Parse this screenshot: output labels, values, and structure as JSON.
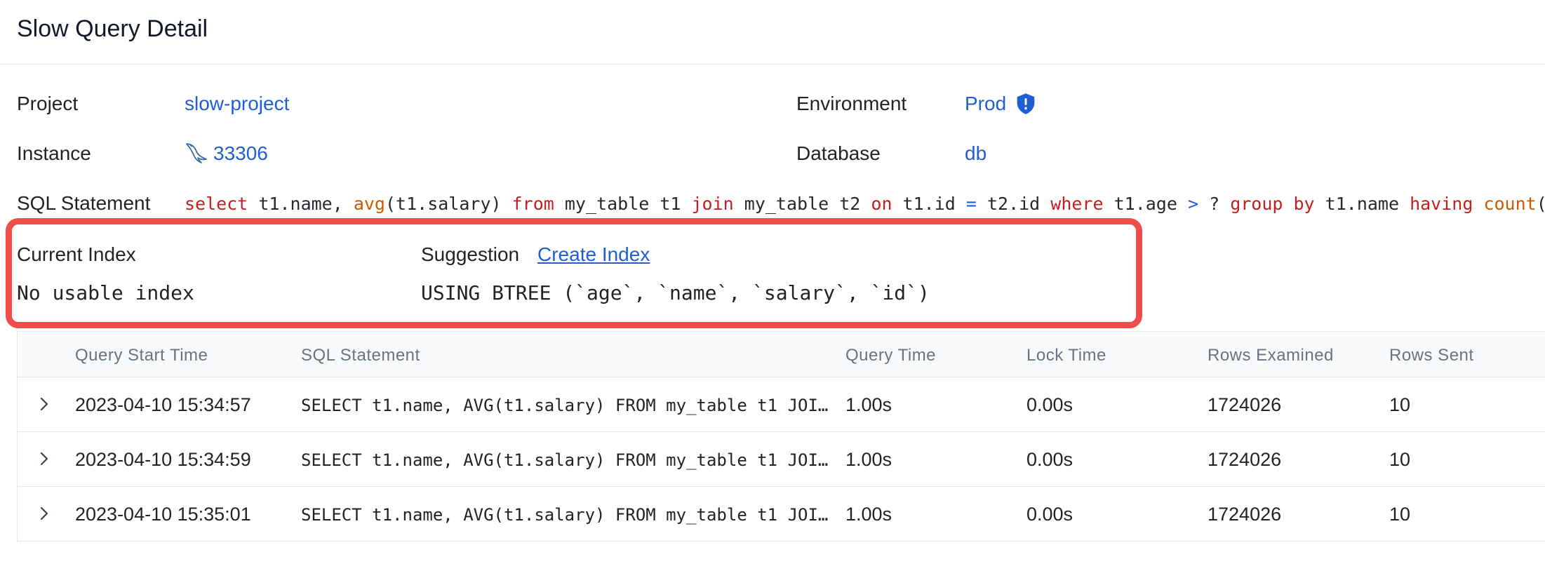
{
  "header": {
    "title": "Slow Query Detail"
  },
  "details": {
    "project_label": "Project",
    "project_value": "slow-project",
    "environment_label": "Environment",
    "environment_value": "Prod",
    "instance_label": "Instance",
    "instance_value": "33306",
    "database_label": "Database",
    "database_value": "db",
    "sql_label": "SQL Statement",
    "sql_tokens": [
      {
        "t": "select",
        "c": "kw"
      },
      {
        "t": " t1.name, ",
        "c": ""
      },
      {
        "t": "avg",
        "c": "fn"
      },
      {
        "t": "(t1.salary) ",
        "c": ""
      },
      {
        "t": "from",
        "c": "kw"
      },
      {
        "t": " my_table t1 ",
        "c": ""
      },
      {
        "t": "join",
        "c": "kw"
      },
      {
        "t": " my_table t2 ",
        "c": ""
      },
      {
        "t": "on",
        "c": "kw"
      },
      {
        "t": " t1.id ",
        "c": ""
      },
      {
        "t": "=",
        "c": "op"
      },
      {
        "t": " t2.id ",
        "c": ""
      },
      {
        "t": "where",
        "c": "kw"
      },
      {
        "t": " t1.age ",
        "c": ""
      },
      {
        "t": ">",
        "c": "op"
      },
      {
        "t": " ? ",
        "c": ""
      },
      {
        "t": "group by",
        "c": "kw"
      },
      {
        "t": " t1.name ",
        "c": ""
      },
      {
        "t": "having",
        "c": "kw"
      },
      {
        "t": " ",
        "c": ""
      },
      {
        "t": "count",
        "c": "fn"
      },
      {
        "t": "(",
        "c": ""
      },
      {
        "t": "*",
        "c": "op"
      },
      {
        "t": ") ",
        "c": ""
      },
      {
        "t": ">",
        "c": "op"
      }
    ]
  },
  "index_advice": {
    "current_label": "Current Index",
    "current_value": "No usable index",
    "suggestion_label": "Suggestion",
    "create_link": "Create Index",
    "suggestion_value": "USING BTREE (`age`, `name`, `salary`, `id`)"
  },
  "table": {
    "columns": [
      "Query Start Time",
      "SQL Statement",
      "Query Time",
      "Lock Time",
      "Rows Examined",
      "Rows Sent"
    ],
    "rows": [
      {
        "start": "2023-04-10 15:34:57",
        "sql": "SELECT t1.name, AVG(t1.salary) FROM my_table t1 JOI…",
        "query_time": "1.00s",
        "lock_time": "0.00s",
        "rows_examined": "1724026",
        "rows_sent": "10"
      },
      {
        "start": "2023-04-10 15:34:59",
        "sql": "SELECT t1.name, AVG(t1.salary) FROM my_table t1 JOI…",
        "query_time": "1.00s",
        "lock_time": "0.00s",
        "rows_examined": "1724026",
        "rows_sent": "10"
      },
      {
        "start": "2023-04-10 15:35:01",
        "sql": "SELECT t1.name, AVG(t1.salary) FROM my_table t1 JOI…",
        "query_time": "1.00s",
        "lock_time": "0.00s",
        "rows_examined": "1724026",
        "rows_sent": "10"
      }
    ]
  },
  "colors": {
    "link": "#1f5fd6",
    "keyword": "#c81e1e",
    "function": "#d05a00",
    "highlight": "#f04c49"
  },
  "icons": {
    "environment": "shield-icon",
    "instance": "mysql-dolphin-icon",
    "expand": "chevron-right-icon"
  }
}
